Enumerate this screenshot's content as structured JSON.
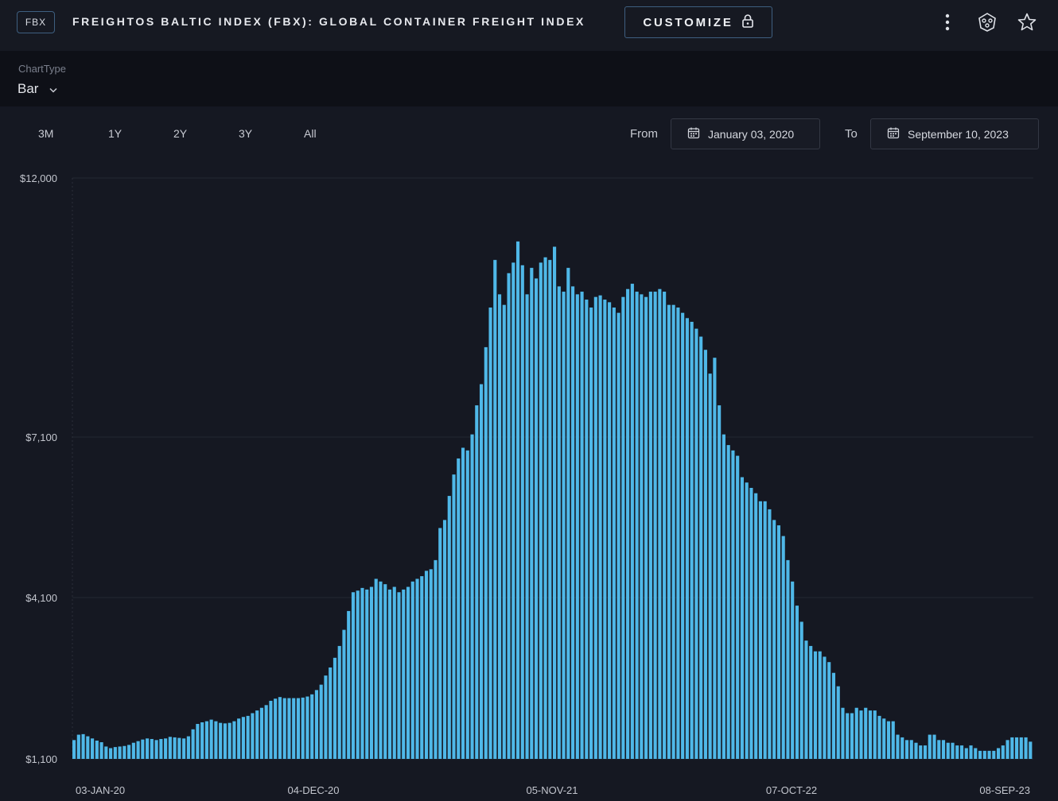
{
  "header": {
    "badge": "FBX",
    "title": "FREIGHTOS BALTIC INDEX (FBX): GLOBAL CONTAINER FREIGHT INDEX",
    "customize_label": "CUSTOMIZE",
    "icons": [
      "lock-icon",
      "more-vertical-icon",
      "share-icon",
      "star-icon"
    ]
  },
  "chart_type": {
    "label": "ChartType",
    "value": "Bar"
  },
  "ranges": [
    "3M",
    "1Y",
    "2Y",
    "3Y",
    "All"
  ],
  "date_range": {
    "from_label": "From",
    "from": "January 03, 2020",
    "to_label": "To",
    "to": "September 10, 2023"
  },
  "colors": {
    "background": "#151822",
    "bar": "#4fb8e8",
    "accent_border": "#3e5f80"
  },
  "chart_data": {
    "type": "bar",
    "title": "",
    "xlabel": "",
    "ylabel": "",
    "y_ticks": [
      "$12,000",
      "$7,100",
      "$4,100",
      "$1,100"
    ],
    "x_ticks": [
      "03-JAN-20",
      "04-DEC-20",
      "05-NOV-21",
      "07-OCT-22",
      "08-SEP-23"
    ],
    "grid": true,
    "series": [
      {
        "values": [
          1450,
          1550,
          1560,
          1520,
          1480,
          1440,
          1410,
          1330,
          1300,
          1320,
          1330,
          1340,
          1360,
          1400,
          1430,
          1460,
          1480,
          1470,
          1450,
          1470,
          1480,
          1510,
          1500,
          1490,
          1480,
          1520,
          1650,
          1750,
          1780,
          1800,
          1830,
          1800,
          1770,
          1760,
          1770,
          1800,
          1850,
          1880,
          1900,
          1950,
          2000,
          2050,
          2100,
          2180,
          2220,
          2250,
          2230,
          2230,
          2230,
          2230,
          2240,
          2260,
          2300,
          2380,
          2480,
          2650,
          2800,
          2980,
          3200,
          3500,
          3850,
          4200,
          4230,
          4280,
          4250,
          4300,
          4450,
          4400,
          4350,
          4250,
          4300,
          4200,
          4250,
          4300,
          4400,
          4450,
          4500,
          4600,
          4630,
          4800,
          5400,
          5550,
          6000,
          6400,
          6700,
          6900,
          6850,
          7150,
          7700,
          8100,
          8800,
          9550,
          10450,
          9800,
          9600,
          10200,
          10400,
          10800,
          10350,
          9800,
          10300,
          10100,
          10400,
          10500,
          10450,
          10700,
          9950,
          9850,
          10300,
          9950,
          9800,
          9850,
          9700,
          9550,
          9750,
          9780,
          9700,
          9650,
          9550,
          9450,
          9750,
          9900,
          10000,
          9850,
          9800,
          9750,
          9850,
          9850,
          9900,
          9850,
          9600,
          9600,
          9550,
          9450,
          9350,
          9280,
          9150,
          9000,
          8750,
          8300,
          8600,
          7700,
          7150,
          6950,
          6850,
          6750,
          6350,
          6250,
          6150,
          6050,
          5900,
          5900,
          5750,
          5550,
          5450,
          5250,
          4800,
          4400,
          3950,
          3650,
          3300,
          3200,
          3100,
          3100,
          3000,
          2900,
          2700,
          2450,
          2050,
          1950,
          1950,
          2050,
          2000,
          2050,
          2000,
          2000,
          1900,
          1850,
          1800,
          1800,
          1550,
          1500,
          1450,
          1450,
          1400,
          1350,
          1350,
          1550,
          1550,
          1450,
          1450,
          1400,
          1400,
          1350,
          1350,
          1300,
          1350,
          1300,
          1250,
          1250,
          1250,
          1250,
          1300,
          1350,
          1450,
          1500,
          1500,
          1500,
          1500,
          1420
        ]
      }
    ]
  }
}
